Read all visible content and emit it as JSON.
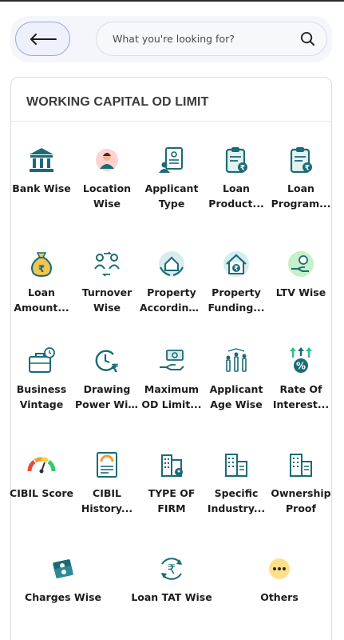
{
  "header": {
    "back_icon": "arrow-left-icon",
    "search_placeholder": "What you're looking for?",
    "search_icon": "search-icon"
  },
  "section": {
    "title": "WORKING CAPITAL OD LIMIT"
  },
  "colors": {
    "accent_teal": "#1a6b75",
    "back_border": "#9aa8d8",
    "others_yellow": "#ffe08a"
  },
  "tiles": [
    {
      "l1": "Bank Wise",
      "l2": "",
      "icon": "bank-icon"
    },
    {
      "l1": "Location",
      "l2": "Wise",
      "icon": "location-person-icon"
    },
    {
      "l1": "Applicant",
      "l2": "Type",
      "icon": "applicant-certificate-icon"
    },
    {
      "l1": "Loan",
      "l2": "Product...",
      "icon": "clipboard-rupee-icon"
    },
    {
      "l1": "Loan",
      "l2": "Program...",
      "icon": "clipboard-rupee-icon"
    },
    {
      "l1": "Loan",
      "l2": "Amount...",
      "icon": "money-bag-icon"
    },
    {
      "l1": "Turnover",
      "l2": "Wise",
      "icon": "turnover-exchange-icon"
    },
    {
      "l1": "Property",
      "l2": "According...",
      "icon": "house-hands-icon"
    },
    {
      "l1": "Property",
      "l2": "Funding...",
      "icon": "house-rupee-icon"
    },
    {
      "l1": "LTV Wise",
      "l2": "",
      "icon": "hand-coin-icon"
    },
    {
      "l1": "Business",
      "l2": "Vintage",
      "icon": "briefcase-clock-icon"
    },
    {
      "l1": "Drawing",
      "l2": "Power Wise",
      "icon": "clock-rupee-icon"
    },
    {
      "l1": "Maximum",
      "l2": "OD Limit...",
      "icon": "hand-cash-icon"
    },
    {
      "l1": "Applicant",
      "l2": "Age Wise",
      "icon": "family-age-icon"
    },
    {
      "l1": "Rate Of",
      "l2": "Interest...",
      "icon": "percent-growth-icon"
    },
    {
      "l1": "CIBIL Score",
      "l2": "",
      "icon": "gauge-icon"
    },
    {
      "l1": "CIBIL",
      "l2": "History...",
      "icon": "credit-report-icon"
    },
    {
      "l1": "TYPE OF",
      "l2": "FIRM",
      "icon": "firm-building-icon"
    },
    {
      "l1": "Specific",
      "l2": "Industry...",
      "icon": "industry-building-icon"
    },
    {
      "l1": "Ownership",
      "l2": "Proof",
      "icon": "ownership-document-icon"
    },
    {
      "l1": "Charges Wise",
      "l2": "",
      "icon": "cash-charges-icon"
    },
    {
      "l1": "Loan TAT Wise",
      "l2": "",
      "icon": "rupee-cycle-icon"
    },
    {
      "l1": "Others",
      "l2": "",
      "icon": "more-dots-icon"
    }
  ]
}
